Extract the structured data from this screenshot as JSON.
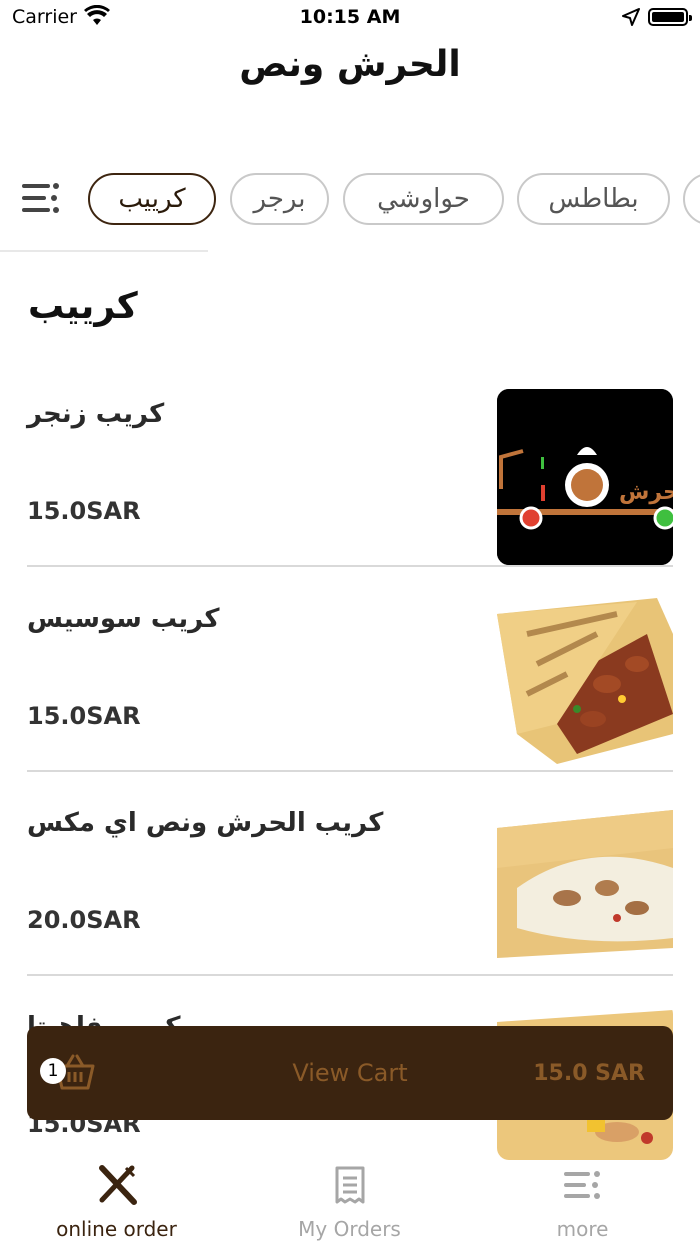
{
  "status_bar": {
    "carrier": "Carrier",
    "time": "10:15 AM"
  },
  "header": {
    "title": "الحرش ونص"
  },
  "categories": [
    {
      "label": "كرييب",
      "active": true
    },
    {
      "label": "برجر",
      "active": false
    },
    {
      "label": "حواوشي",
      "active": false
    },
    {
      "label": "بطاطس",
      "active": false
    }
  ],
  "section": {
    "title": "كرييب"
  },
  "items": [
    {
      "name": "كريب زنجر",
      "price": "15.0SAR",
      "image": "restaurant-logo"
    },
    {
      "name": "كريب سوسيس",
      "price": "15.0SAR",
      "image": "crepe-sausage-photo"
    },
    {
      "name": "كريب الحرش ونص اي مكس",
      "price": "20.0SAR",
      "image": "crepe-mix-photo"
    },
    {
      "name": "كريب فاهيتا",
      "price": "15.0SAR",
      "image": "crepe-fajita-photo"
    }
  ],
  "cart": {
    "count": "1",
    "label": "View Cart",
    "total": "15.0 SAR"
  },
  "tabbar": {
    "tabs": [
      {
        "label": "online order",
        "icon": "fork-knife-icon",
        "active": true
      },
      {
        "label": "My Orders",
        "icon": "receipt-icon",
        "active": false
      },
      {
        "label": "more",
        "icon": "menu-icon",
        "active": false
      }
    ]
  },
  "colors": {
    "brand": "#3b2410",
    "accent": "#8a5a28"
  }
}
